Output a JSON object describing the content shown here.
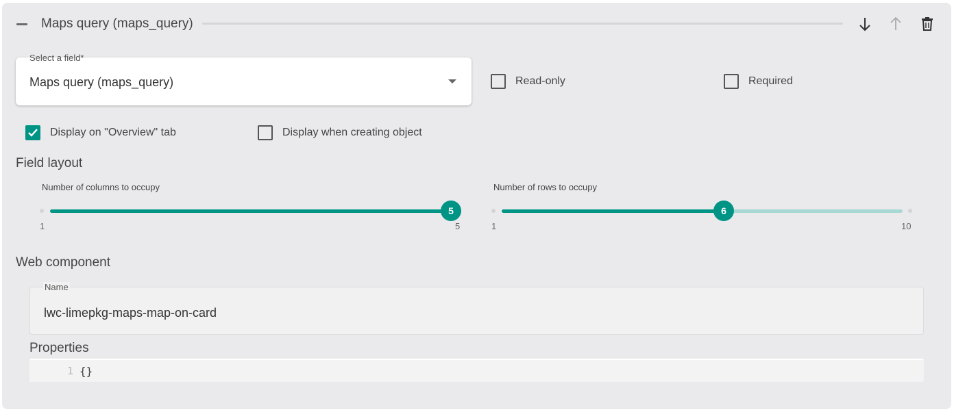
{
  "header": {
    "title": "Maps query (maps_query)",
    "icons": [
      "minus-icon",
      "arrow-down-icon",
      "arrow-up-icon",
      "trash-icon"
    ]
  },
  "field_select": {
    "label": "Select a field*",
    "value": "Maps query (maps_query)"
  },
  "checkboxes": {
    "read_only": {
      "label": "Read-only",
      "checked": false
    },
    "required": {
      "label": "Required",
      "checked": false
    },
    "display_overview": {
      "label": "Display on \"Overview\" tab",
      "checked": true
    },
    "display_creating": {
      "label": "Display when creating object",
      "checked": false
    }
  },
  "field_layout": {
    "title": "Field layout",
    "columns": {
      "label": "Number of columns to occupy",
      "min": "1",
      "max": "5",
      "value": "5"
    },
    "rows": {
      "label": "Number of rows to occupy",
      "min": "1",
      "max": "10",
      "value": "6"
    }
  },
  "web_component": {
    "title": "Web component",
    "name_label": "Name",
    "name_value": "lwc-limepkg-maps-map-on-card",
    "properties_label": "Properties",
    "editor": {
      "line_number": "1",
      "code": "{}"
    }
  },
  "colors": {
    "accent": "#009485",
    "accent_light": "#a8d8d3",
    "panel_bg": "#eaeaec"
  }
}
